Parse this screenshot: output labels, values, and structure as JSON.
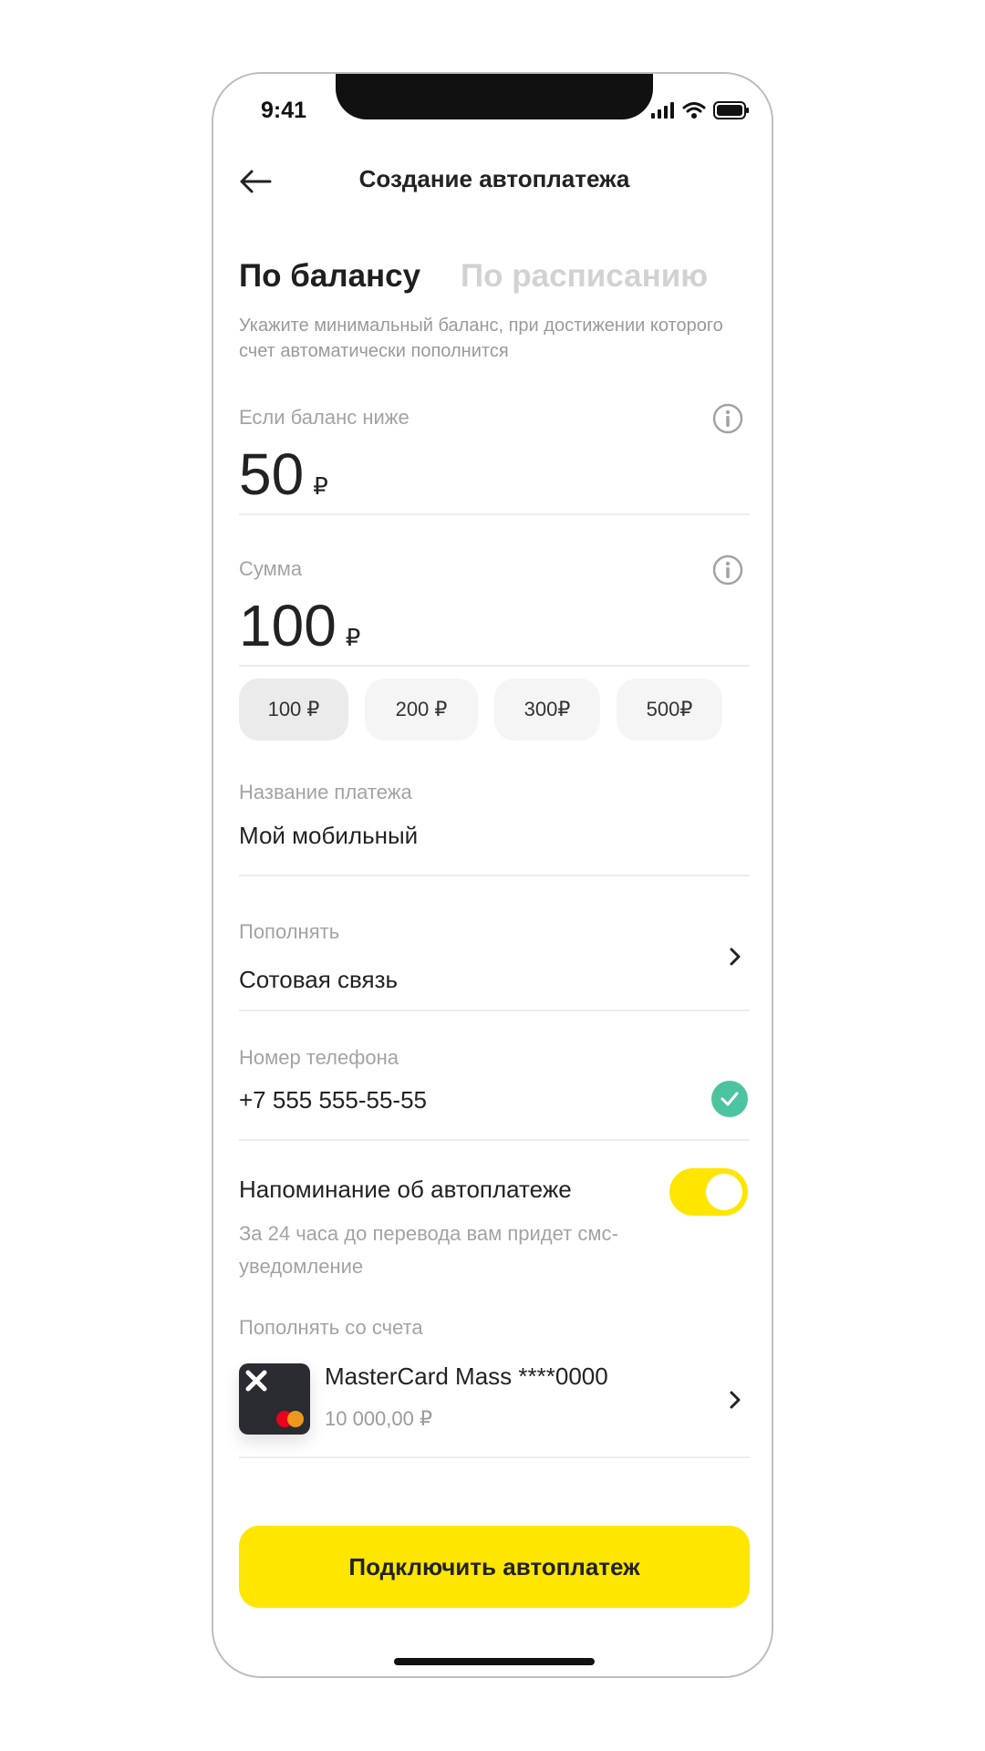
{
  "status": {
    "time": "9:41"
  },
  "header": {
    "title": "Создание автоплатежа"
  },
  "tabs": [
    {
      "label": "По балансу",
      "active": true
    },
    {
      "label": "По расписанию",
      "active": false
    }
  ],
  "hint": "Укажите минимальный баланс, при достижении которого счет автоматически пополнится",
  "threshold": {
    "label": "Если баланс ниже",
    "value": "50",
    "currency": "₽"
  },
  "amount": {
    "label": "Сумма",
    "value": "100",
    "currency": "₽",
    "chips": [
      "100 ₽",
      "200 ₽",
      "300₽",
      "500₽"
    ],
    "selected_chip": 0
  },
  "payment_name": {
    "label": "Название платежа",
    "value": "Мой мобильный"
  },
  "top_up": {
    "label": "Пополнять",
    "value": "Сотовая связь"
  },
  "phone": {
    "label": "Номер телефона",
    "value": "+7 555 555-55-55",
    "valid": true
  },
  "reminder": {
    "title": "Напоминание об автоплатеже",
    "description": "За 24 часа до перевода вам придет смс-уведомление",
    "enabled": true
  },
  "source": {
    "label": "Пополнять со счета",
    "card_name": "MasterCard Mass ****0000",
    "balance": "10 000,00 ₽"
  },
  "cta": {
    "label": "Подключить автоплатеж"
  },
  "colors": {
    "accent": "#ffe600",
    "success": "#4dc4a0",
    "muted_text": "#a3a3a3"
  }
}
